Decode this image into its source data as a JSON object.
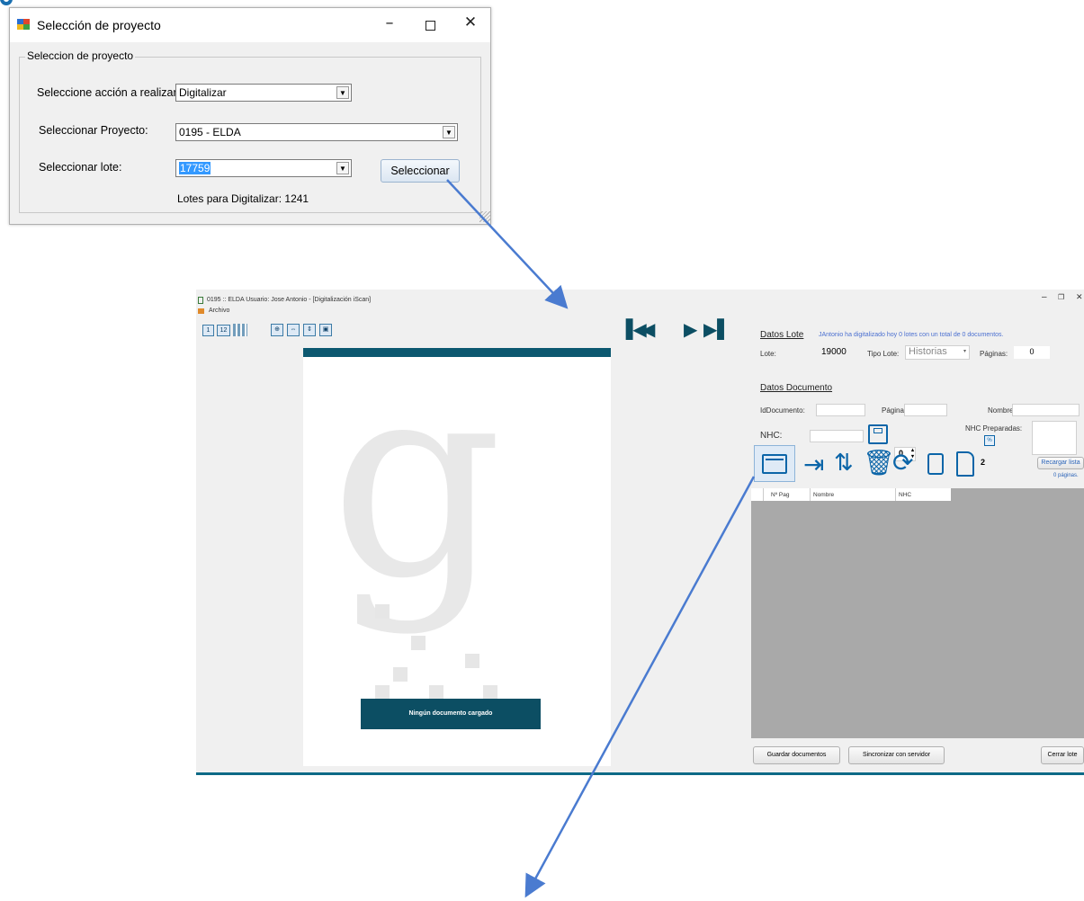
{
  "dialog": {
    "title": "Selección de proyecto",
    "group_label": "Seleccion de proyecto",
    "action_label": "Seleccione acción a realizar:",
    "action_value": "Digitalizar",
    "project_label": "Seleccionar Proyecto:",
    "project_value": "0195 - ELDA",
    "lote_label": "Seleccionar lote:",
    "lote_value": "17759",
    "select_button": "Seleccionar",
    "lotes_info": "Lotes para Digitalizar: 1241"
  },
  "main": {
    "title": "0195 :: ELDA Usuario: Jose Antonio - [Digitalización iScan]",
    "menu_archivo": "Archivo",
    "toolbar": [
      "1",
      "12"
    ],
    "viewer_message": "Ningún documento cargado",
    "datos_lote": {
      "header": "Datos Lote",
      "info": "JAntonio ha digitalizado hoy 0 lotes con un total de 0 documentos.",
      "lote_label": "Lote:",
      "lote_value": "19000",
      "tipo_label": "Tipo Lote:",
      "tipo_value": "Historias",
      "paginas_label": "Páginas:",
      "paginas_value": "0"
    },
    "datos_documento": {
      "header": "Datos Documento",
      "iddoc_label": "IdDocumento:",
      "pagina_label": "Página:",
      "nombre_label": "Nombre:",
      "nhc_label": "NHC:",
      "stepper_value": "0",
      "nhc_prep_label": "NHC Preparadas:",
      "page_count": "2",
      "reload_button": "Recargar lista",
      "pages_text": "0 páginas."
    },
    "grid_columns": [
      "Nº Pag",
      "Nombre",
      "NHC"
    ],
    "buttons": {
      "guardar": "Guardar documentos",
      "sincronizar": "Sincronizar con servidor",
      "cerrar": "Cerrar lote"
    }
  },
  "colors": {
    "accent": "#0c4e63",
    "arrow": "#4a7bd0",
    "icon": "#0b65a8"
  }
}
